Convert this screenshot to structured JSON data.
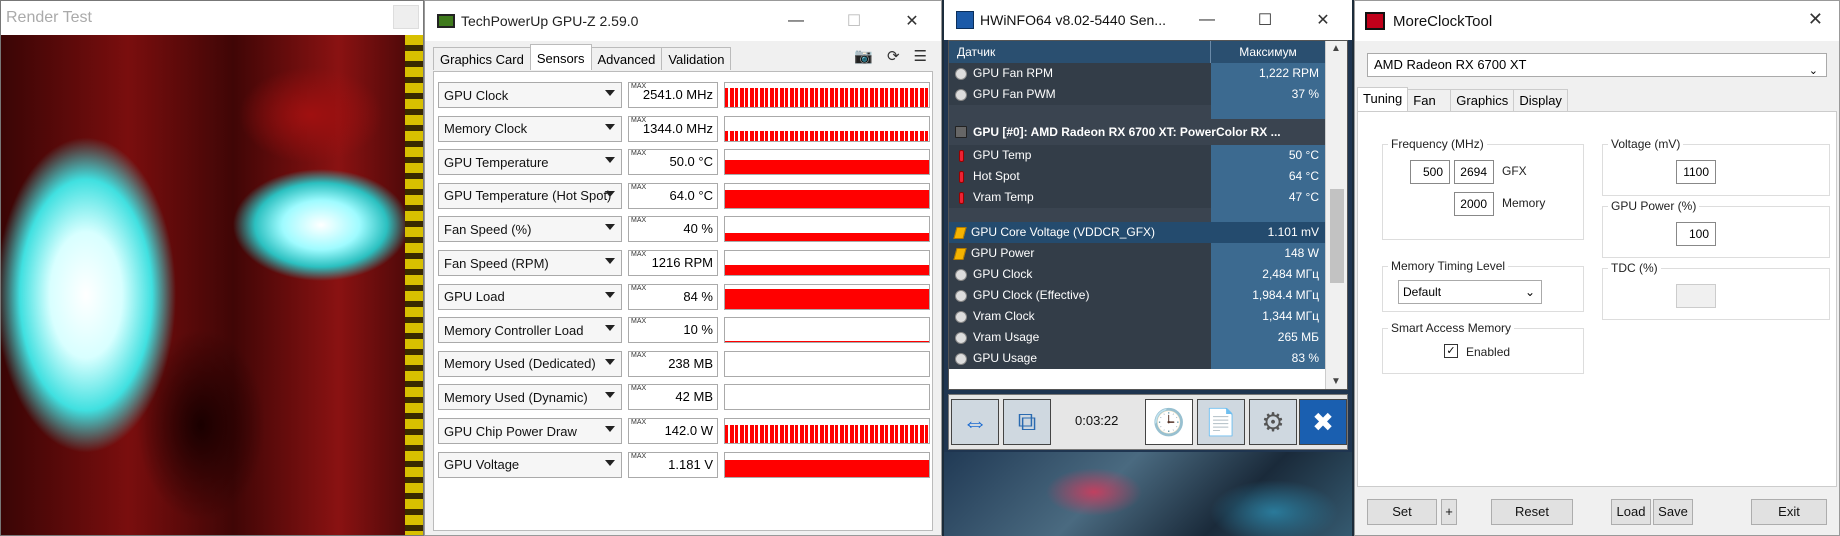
{
  "render_test": {
    "title": "Render Test"
  },
  "gpuz": {
    "title": "TechPowerUp GPU-Z 2.59.0",
    "tabs": [
      "Graphics Card",
      "Sensors",
      "Advanced",
      "Validation"
    ],
    "max_tag": "MAX",
    "sensors": [
      {
        "name": "GPU Clock",
        "value": "2541.0 MHz",
        "graph": "spiky",
        "level": 0.8
      },
      {
        "name": "Memory Clock",
        "value": "1344.0 MHz",
        "graph": "spiky",
        "level": 0.4
      },
      {
        "name": "GPU Temperature",
        "value": "50.0 °C",
        "graph": "solid",
        "level": 0.6
      },
      {
        "name": "GPU Temperature (Hot Spot)",
        "value": "64.0 °C",
        "graph": "solid",
        "level": 0.75
      },
      {
        "name": "Fan Speed (%)",
        "value": "40 %",
        "graph": "solid",
        "level": 0.35
      },
      {
        "name": "Fan Speed (RPM)",
        "value": "1216 RPM",
        "graph": "solid",
        "level": 0.4
      },
      {
        "name": "GPU Load",
        "value": "84 %",
        "graph": "solid",
        "level": 0.8
      },
      {
        "name": "Memory Controller Load",
        "value": "10 %",
        "graph": "solid",
        "level": 0.05
      },
      {
        "name": "Memory Used (Dedicated)",
        "value": "238 MB",
        "graph": "none",
        "level": 0
      },
      {
        "name": "Memory Used (Dynamic)",
        "value": "42 MB",
        "graph": "none",
        "level": 0
      },
      {
        "name": "GPU Chip Power Draw",
        "value": "142.0 W",
        "graph": "spiky",
        "level": 0.75
      },
      {
        "name": "GPU Voltage",
        "value": "1.181 V",
        "graph": "solid",
        "level": 0.7
      }
    ]
  },
  "hwinfo": {
    "title": "HWiNFO64 v8.02-5440 Sen...",
    "col_sensor": "Датчик",
    "col_max": "Максимум",
    "elapsed": "0:03:22",
    "rows": [
      {
        "kind": "row",
        "icon": "fan-icon",
        "name": "GPU Fan RPM",
        "value": "1,222 RPM"
      },
      {
        "kind": "row",
        "icon": "fan-icon",
        "name": "GPU Fan PWM",
        "value": "37 %"
      },
      {
        "kind": "blank",
        "icon": "",
        "name": "",
        "value": ""
      },
      {
        "kind": "group",
        "icon": "chip-icon",
        "name": "GPU [#0]: AMD Radeon RX 6700 XT: PowerColor RX ...",
        "value": ""
      },
      {
        "kind": "row",
        "icon": "thermometer-icon",
        "name": "GPU Temp",
        "value": "50 °C"
      },
      {
        "kind": "row",
        "icon": "thermometer-icon",
        "name": "Hot Spot",
        "value": "64 °C"
      },
      {
        "kind": "row",
        "icon": "thermometer-icon",
        "name": "Vram Temp",
        "value": "47 °C"
      },
      {
        "kind": "blank",
        "icon": "",
        "name": "",
        "value": ""
      },
      {
        "kind": "hl",
        "icon": "voltage-icon",
        "name": "GPU Core Voltage (VDDCR_GFX)",
        "value": "1.101 mV"
      },
      {
        "kind": "row",
        "icon": "voltage-icon",
        "name": "GPU Power",
        "value": "148 W"
      },
      {
        "kind": "row",
        "icon": "clock-icon",
        "name": "GPU Clock",
        "value": "2,484 МГц"
      },
      {
        "kind": "row",
        "icon": "clock-icon",
        "name": "GPU Clock (Effective)",
        "value": "1,984.4 МГц"
      },
      {
        "kind": "row",
        "icon": "clock-icon",
        "name": "Vram Clock",
        "value": "1,344 МГц"
      },
      {
        "kind": "row",
        "icon": "clock-icon",
        "name": "Vram Usage",
        "value": "265 МБ"
      },
      {
        "kind": "row",
        "icon": "clock-icon",
        "name": "GPU Usage",
        "value": "83 %"
      }
    ]
  },
  "mct": {
    "title": "MoreClockTool",
    "device": "AMD Radeon RX 6700 XT",
    "tabs": [
      "Tuning",
      "Fan",
      "Graphics",
      "Display"
    ],
    "freq_label": "Frequency (MHz)",
    "freq_min": "500",
    "freq_max": "2694",
    "gfx_label": "GFX",
    "mem_val": "2000",
    "mem_label": "Memory",
    "voltage_label": "Voltage (mV)",
    "voltage_val": "1100",
    "power_label": "GPU Power (%)",
    "power_val": "100",
    "tdc_label": "TDC (%)",
    "tdc_val": "",
    "timing_label": "Memory Timing Level",
    "timing_val": "Default",
    "sam_label": "Smart Access Memory",
    "sam_enabled": "Enabled",
    "buttons": {
      "set": "Set",
      "plus": "+",
      "reset": "Reset",
      "load": "Load",
      "save": "Save",
      "exit": "Exit"
    }
  }
}
